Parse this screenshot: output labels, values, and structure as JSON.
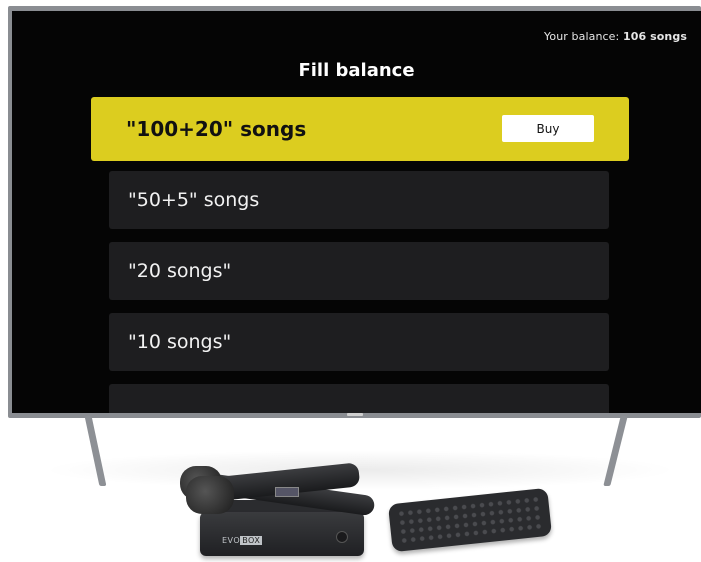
{
  "balance": {
    "label": "Your balance: ",
    "value": "106 songs"
  },
  "screen": {
    "title": "Fill balance"
  },
  "packages": [
    {
      "label": "\"100+20\" songs",
      "selected": true,
      "action_label": "Buy"
    },
    {
      "label": "\"50+5\" songs",
      "selected": false
    },
    {
      "label": "\"20 songs\"",
      "selected": false
    },
    {
      "label": "\"10 songs\"",
      "selected": false
    },
    {
      "label": "",
      "selected": false
    }
  ],
  "device": {
    "box_brand_left": "EVO",
    "box_brand_right": "BOX"
  },
  "colors": {
    "accent": "#dccd1f",
    "item_bg": "#1e1e20",
    "screen_bg": "#050505"
  }
}
